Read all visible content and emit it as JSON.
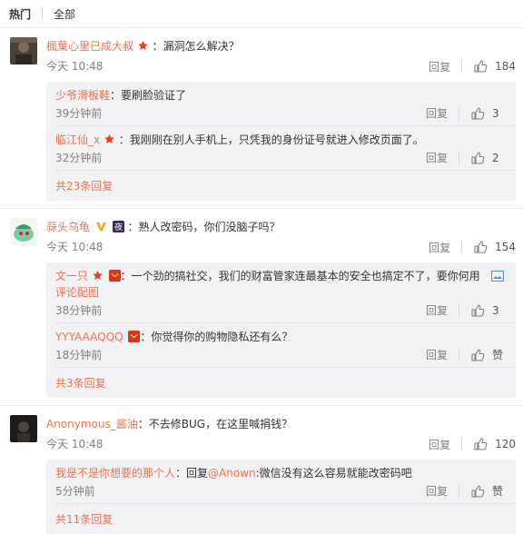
{
  "tabs": {
    "hot": "热门",
    "all": "全部"
  },
  "comments": [
    {
      "user": "楓葉心里已成大叔",
      "text": "：漏洞怎么解决？",
      "time": "今天 10:48",
      "reply_label": "回复",
      "likes": "184",
      "replies": [
        {
          "user": "少爷滑板鞋",
          "text": "：要刷脸验证了",
          "time": "39分钟前",
          "reply_label": "回复",
          "likes": "3"
        },
        {
          "user": "临江仙_x",
          "text": "：我刚刚在别人手机上，只凭我的身份证号就进入修改页面了。",
          "time": "32分钟前",
          "reply_label": "回复",
          "likes": "2"
        }
      ],
      "more": "共23条回复"
    },
    {
      "user": "蒜头乌龟",
      "text": "：熟人改密码，你们没脑子吗？",
      "time": "今天 10:48",
      "reply_label": "回复",
      "likes": "154",
      "replies": [
        {
          "user": "文一只",
          "text": "：一个劲的搞社交，我们的财富管家连最基本的安全也搞定不了，要你何用",
          "text2": "评论配图",
          "time": "38分钟前",
          "reply_label": "回复",
          "likes": "3"
        },
        {
          "user": "YYYAAAQQQ",
          "text": "：你觉得你的购物隐私还有么？",
          "time": "18分钟前",
          "reply_label": "回复",
          "likes": "赞"
        }
      ],
      "more": "共3条回复"
    },
    {
      "user": "Anonymous_酱油",
      "text": "：不去修BUG，在这里喊捐钱？",
      "time": "今天 10:48",
      "reply_label": "回复",
      "likes": "120",
      "replies": [
        {
          "user": "我是不是你想要的那个人",
          "text": "：回复",
          "mention": "@Anown",
          "text_after": ":微信没有这么容易就能改密码吧",
          "time": "5分钟前",
          "reply_label": "回复",
          "likes": "赞"
        }
      ],
      "more": "共11条回复"
    }
  ],
  "colors": {
    "username": "#eb7350",
    "reply_bg": "#f2f2f5",
    "muted": "#808080"
  },
  "icons": {
    "like": "thumbs-up-icon",
    "star": "star-badge-icon",
    "vip": "v-badge-icon",
    "image": "image-icon"
  }
}
